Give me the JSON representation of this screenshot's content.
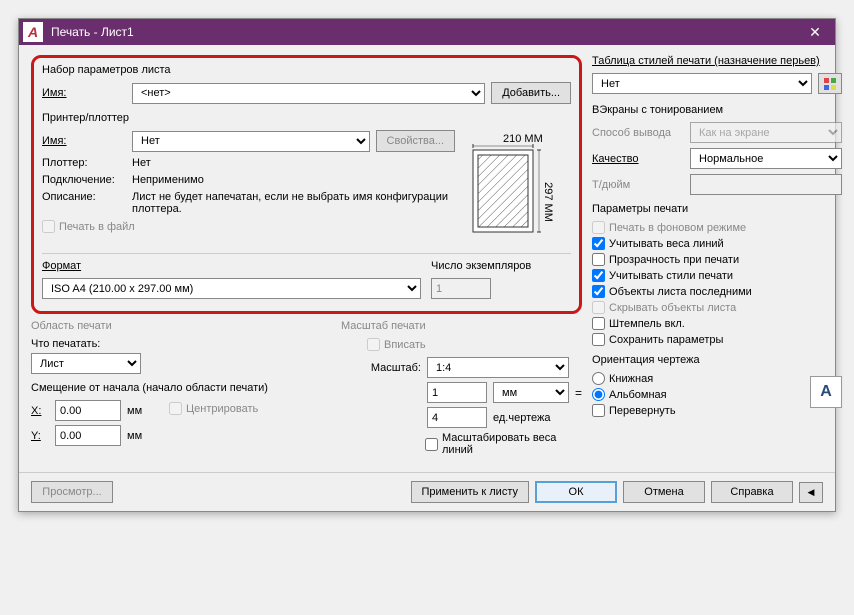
{
  "window": {
    "title": "Печать - Лист1"
  },
  "pageSetup": {
    "title": "Набор параметров листа",
    "nameLabel": "Имя:",
    "nameValue": "<нет>",
    "addBtn": "Добавить..."
  },
  "printer": {
    "title": "Принтер/плоттер",
    "nameLabel": "Имя:",
    "nameValue": "Нет",
    "propsBtn": "Свойства...",
    "plotterLabel": "Плоттер:",
    "plotterValue": "Нет",
    "connLabel": "Подключение:",
    "connValue": "Неприменимо",
    "descLabel": "Описание:",
    "descValue": "Лист не будет напечатан, если не выбрать имя конфигурации плоттера.",
    "toFile": "Печать в файл",
    "previewW": "210 MM",
    "previewH": "297 MM"
  },
  "format": {
    "title": "Формат",
    "value": "ISO A4 (210.00 x 297.00 мм)"
  },
  "copies": {
    "title": "Число экземпляров",
    "value": "1"
  },
  "printArea": {
    "title": "Область печати",
    "whatLabel": "Что печатать:",
    "whatValue": "Лист"
  },
  "scale": {
    "title": "Масштаб печати",
    "fit": "Вписать",
    "scaleLabel": "Масштаб:",
    "scaleValue": "1:4",
    "v1": "1",
    "unit": "мм",
    "v2": "4",
    "unit2": "ед.чертежа",
    "weights": "Масштабировать веса линий"
  },
  "offset": {
    "title": "Смещение от начала (начало области печати)",
    "x": "X:",
    "xv": "0.00",
    "y": "Y:",
    "yv": "0.00",
    "mm": "мм",
    "center": "Центрировать"
  },
  "styleTable": {
    "title": "Таблица стилей печати (назначение перьев)",
    "value": "Нет"
  },
  "shade": {
    "title": "ВЭкраны с тонированием",
    "methodLabel": "Способ вывода",
    "methodValue": "Как на экране",
    "qualityLabel": "Качество",
    "qualityValue": "Нормальное",
    "dpiLabel": "Т/дюйм"
  },
  "options": {
    "title": "Параметры печати",
    "bg": "Печать в фоновом режиме",
    "weights": "Учитывать веса линий",
    "transp": "Прозрачность при печати",
    "styles": "Учитывать стили печати",
    "objlast": "Объекты листа последними",
    "hide": "Скрывать объекты листа",
    "stamp": "Штемпель вкл.",
    "save": "Сохранить параметры"
  },
  "orient": {
    "title": "Ориентация чертежа",
    "portrait": "Книжная",
    "landscape": "Альбомная",
    "flip": "Перевернуть"
  },
  "footer": {
    "preview": "Просмотр...",
    "apply": "Применить к листу",
    "ok": "ОК",
    "cancel": "Отмена",
    "help": "Справка"
  }
}
